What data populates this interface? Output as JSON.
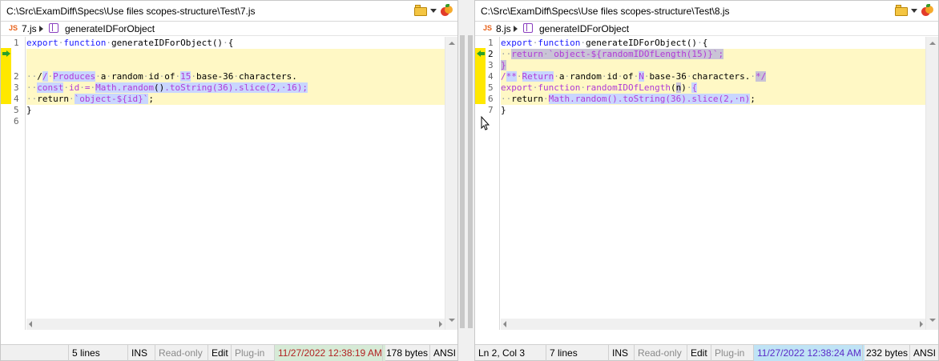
{
  "left": {
    "path": "C:\\Src\\ExamDiff\\Specs\\Use files scopes-structure\\Test\\7.js",
    "breadcrumb": {
      "file_badge": "JS",
      "file": "7.js",
      "symbol": "generateIDForObject"
    },
    "line_numbers": [
      "1",
      "",
      "",
      "2",
      "3",
      "4",
      "5",
      "6"
    ],
    "status": {
      "lines": "5 lines",
      "ins": "INS",
      "readonly": "Read-only",
      "edit": "Edit",
      "plugin": "Plug-in",
      "date": "11/27/2022 12:38:19 AM",
      "size": "178 bytes",
      "encoding": "ANSI"
    }
  },
  "right": {
    "path": "C:\\Src\\ExamDiff\\Specs\\Use files scopes-structure\\Test\\8.js",
    "breadcrumb": {
      "file_badge": "JS",
      "file": "8.js",
      "symbol": "generateIDForObject"
    },
    "line_numbers": [
      "1",
      "2",
      "3",
      "4",
      "5",
      "6",
      "7"
    ],
    "status": {
      "position": "Ln 2, Col 3",
      "lines": "7 lines",
      "ins": "INS",
      "readonly": "Read-only",
      "edit": "Edit",
      "plugin": "Plug-in",
      "date": "11/27/2022 12:38:24 AM",
      "size": "232 bytes",
      "encoding": "ANSI"
    }
  },
  "colors": {
    "diff_bg": "#fff8c5",
    "gutter_mark": "#ffe800",
    "keyword": "#1a1aff",
    "changed_text": "#b13bd6",
    "highlight_purple": "#c9d6ff",
    "highlight_gray": "#c9c3d6"
  },
  "icons": [
    "open-folder-icon",
    "dropdown-caret-icon",
    "examdiff-logo-icon",
    "cube-symbol-icon",
    "diff-arrow-icon"
  ]
}
